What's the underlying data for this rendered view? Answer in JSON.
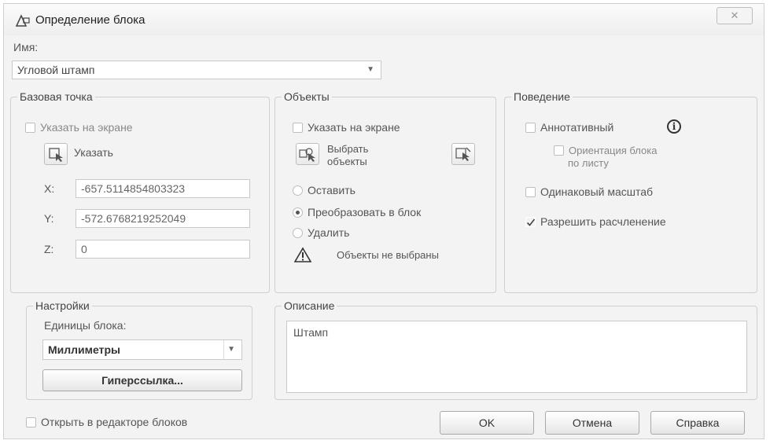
{
  "dialog": {
    "title": "Определение блока",
    "close_glyph": "✕"
  },
  "name": {
    "label": "Имя:",
    "value": "Угловой штамп"
  },
  "base_point": {
    "title": "Базовая точка",
    "specify_on_screen": "Указать на экране",
    "pick_label": "Указать",
    "x_label": "X:",
    "x_value": "-657.5114854803323",
    "y_label": "Y:",
    "y_value": "-572.6768219252049",
    "z_label": "Z:",
    "z_value": "0"
  },
  "objects": {
    "title": "Объекты",
    "specify_on_screen": "Указать на экране",
    "select_label_1": "Выбрать",
    "select_label_2": "объекты",
    "retain": "Оставить",
    "convert": "Преобразовать в блок",
    "delete": "Удалить",
    "warning": "Объекты не выбраны"
  },
  "behavior": {
    "title": "Поведение",
    "annotative": "Аннотативный",
    "match_orientation_1": "Ориентация блока",
    "match_orientation_2": "по листу",
    "uniform_scale": "Одинаковый масштаб",
    "allow_explode": "Разрешить расчленение"
  },
  "settings": {
    "title": "Настройки",
    "units_label": "Единицы блока:",
    "units_value": "Миллиметры",
    "hyperlink": "Гиперссылка..."
  },
  "description": {
    "title": "Описание",
    "value": "Штамп"
  },
  "open_in_editor": "Открыть в редакторе блоков",
  "buttons": {
    "ok": "OK",
    "cancel": "Отмена",
    "help": "Справка"
  },
  "icons": {
    "title": "block-definition-icon",
    "pick_point": "pick-point-icon",
    "select_objects": "select-objects-icon",
    "quick_select": "quick-select-icon",
    "warning": "warning-icon",
    "info": "info-icon"
  }
}
